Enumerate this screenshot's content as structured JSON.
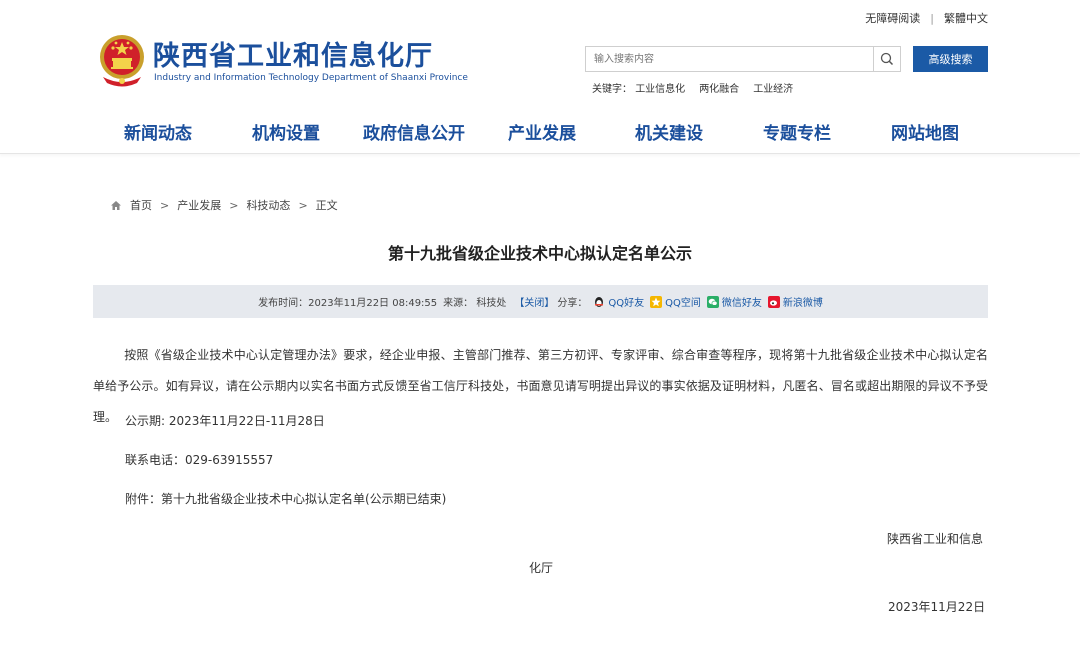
{
  "topbar": {
    "accessibility": "无障碍阅读",
    "separator": "|",
    "traditional": "繁體中文"
  },
  "header": {
    "site_title": "陕西省工业和信息化厅",
    "site_subtitle": "Industry and Information Technology Department of Shaanxi Province",
    "search_placeholder": "输入搜索内容",
    "advanced_search": "高级搜索",
    "keywords_label": "关键字：",
    "keywords": [
      "工业信息化",
      "两化融合",
      "工业经济"
    ]
  },
  "nav": {
    "items": [
      "新闻动态",
      "机构设置",
      "政府信息公开",
      "产业发展",
      "机关建设",
      "专题专栏",
      "网站地图"
    ]
  },
  "breadcrumb": {
    "home": "首页",
    "items": [
      "产业发展",
      "科技动态",
      "正文"
    ],
    "separator": ">"
  },
  "article": {
    "title": "第十九批省级企业技术中心拟认定名单公示",
    "meta": {
      "publish": "发布时间：2023年11月22日 08:49:55",
      "source": "来源： 科技处",
      "close": "【关闭】",
      "share_label": "分享：",
      "shares": [
        "QQ好友",
        "QQ空间",
        "微信好友",
        "新浪微博"
      ]
    },
    "paragraph": "按照《省级企业技术中心认定管理办法》要求，经企业申报、主管部门推荐、第三方初评、专家评审、综合审查等程序，现将第十九批省级企业技术中心拟认定名单给予公示。如有异议，请在公示期内以实名书面方式反馈至省工信厅科技处，书面意见请写明提出异议的事实依据及证明材料，凡匿名、冒名或超出期限的异议不予受理。",
    "period": "公示期: 2023年11月22日-11月28日",
    "phone": "联系电话：029-63915557",
    "attachment": "附件：第十九批省级企业技术中心拟认定名单(公示期已结束)",
    "sign_line1": "陕西省工业和信息",
    "sign_line2": "化厅",
    "date": "2023年11月22日"
  },
  "colors": {
    "brand_blue": "#1b4f9c",
    "button_blue": "#1b5aa6",
    "meta_bg": "#e6e9ee"
  }
}
